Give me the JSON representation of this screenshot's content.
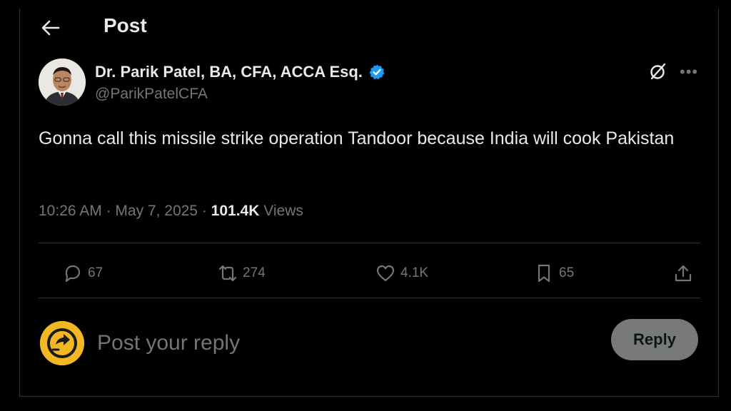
{
  "header": {
    "title": "Post"
  },
  "author": {
    "name": "Dr. Parik Patel, BA, CFA, ACCA Esq.",
    "handle": "@ParikPatelCFA",
    "verified": true
  },
  "post": {
    "text": "Gonna call this missile strike operation Tandoor because India will cook Pakistan",
    "time": "10:26 AM",
    "date": "May 7, 2025",
    "views_count": "101.4K",
    "views_label": "Views"
  },
  "actions": {
    "replies": "67",
    "reposts": "274",
    "likes": "4.1K",
    "bookmarks": "65"
  },
  "reply": {
    "placeholder": "Post your reply",
    "button_label": "Reply"
  },
  "icons": [
    "back-arrow-icon",
    "verified-badge-icon",
    "grok-icon",
    "more-icon",
    "reply-icon",
    "repost-icon",
    "like-icon",
    "bookmark-icon",
    "share-icon"
  ],
  "colors": {
    "background": "#000000",
    "text": "#e7e9ea",
    "muted": "#71767b",
    "verified": "#1d9bf0",
    "reply_avatar": "#f2b824",
    "reply_button": "#787a7a"
  }
}
